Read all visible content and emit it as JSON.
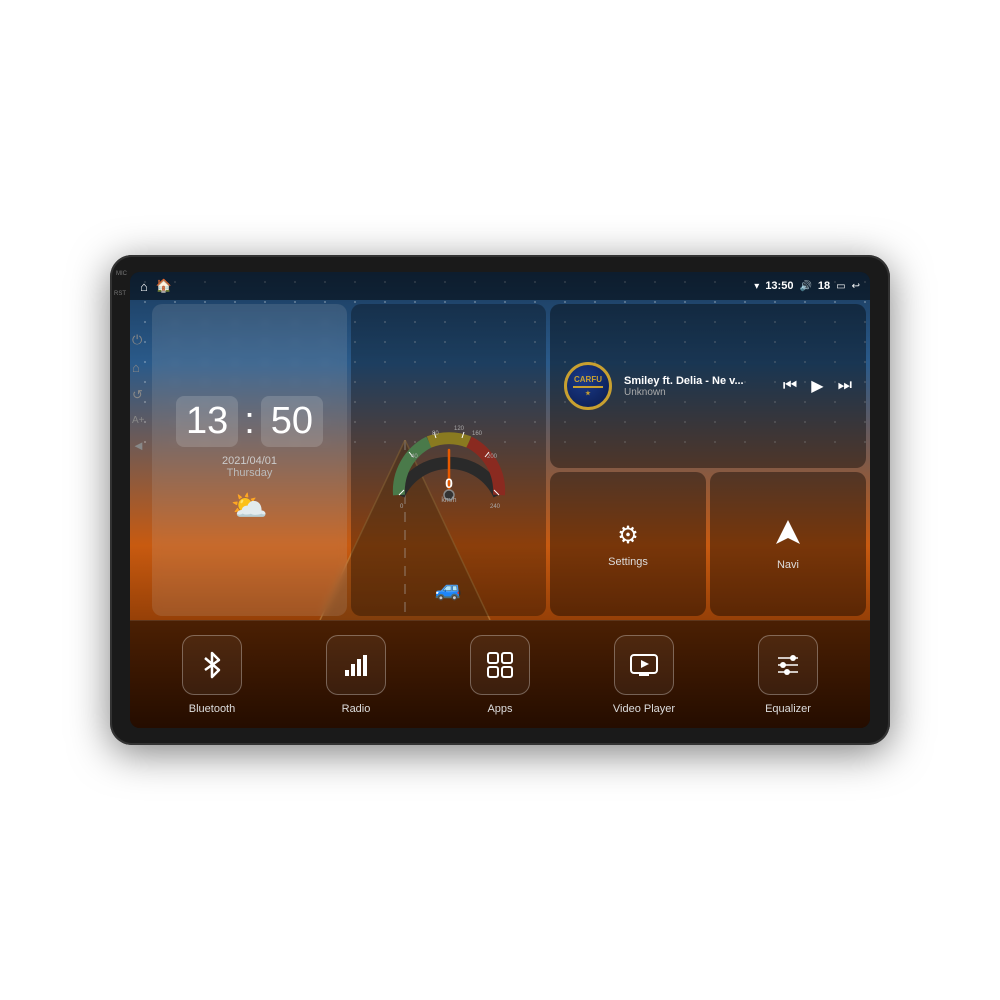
{
  "device": {
    "status_bar": {
      "wifi_icon": "▾",
      "time": "13:50",
      "volume_icon": "🔊",
      "volume_level": "18",
      "battery_icon": "▭",
      "back_icon": "↩"
    },
    "mic_label": "MIC",
    "rst_label": "RST"
  },
  "clock_widget": {
    "time_h": "13",
    "time_m": "50",
    "date": "2021/04/01",
    "day": "Thursday",
    "weather_icon": "⛅"
  },
  "music_widget": {
    "logo_text": "CARFU",
    "song_title": "Smiley ft. Delia - Ne v...",
    "song_artist": "Unknown",
    "prev_icon": "⏮",
    "play_icon": "▶",
    "next_icon": "⏭"
  },
  "settings_card": {
    "icon": "⚙",
    "label": "Settings"
  },
  "navi_card": {
    "icon": "⬆",
    "label": "Navi"
  },
  "bottom_items": [
    {
      "id": "bluetooth",
      "icon": "ᛒ",
      "label": "Bluetooth"
    },
    {
      "id": "radio",
      "icon": "📶",
      "label": "Radio"
    },
    {
      "id": "apps",
      "icon": "⊞",
      "label": "Apps"
    },
    {
      "id": "video-player",
      "icon": "📺",
      "label": "Video Player"
    },
    {
      "id": "equalizer",
      "icon": "⚌",
      "label": "Equalizer"
    }
  ],
  "side_controls": [
    {
      "id": "power",
      "icon": "⏻"
    },
    {
      "id": "home",
      "icon": "⌂"
    },
    {
      "id": "back",
      "icon": "↺"
    },
    {
      "id": "add",
      "icon": "A+"
    },
    {
      "id": "back2",
      "icon": "◄"
    }
  ]
}
